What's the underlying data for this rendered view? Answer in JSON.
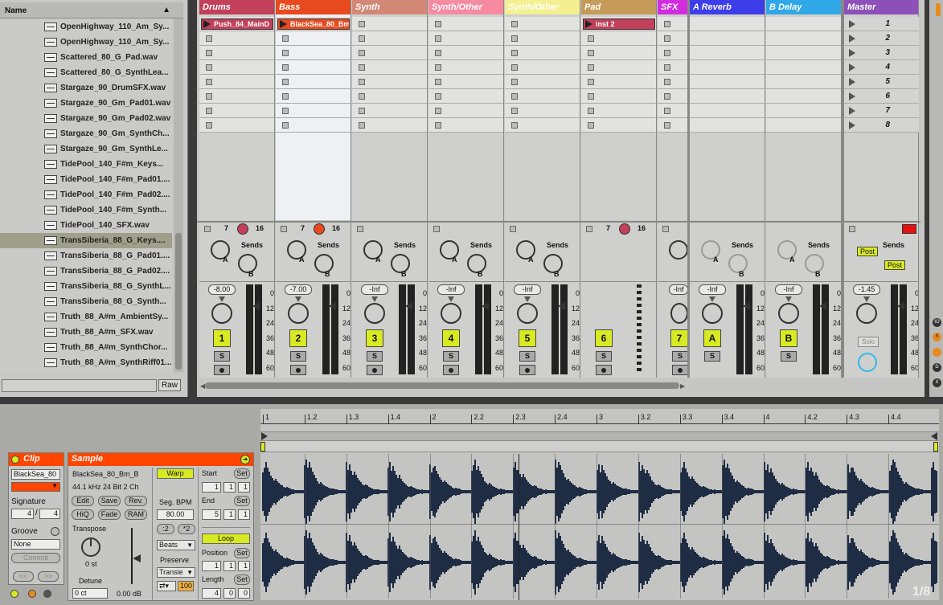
{
  "browser": {
    "header": "Name",
    "files": [
      "OpenHighway_110_Am_Sy...",
      "OpenHighway_110_Am_Sy...",
      "Scattered_80_G_Pad.wav",
      "Scattered_80_G_SynthLea...",
      "Stargaze_90_DrumSFX.wav",
      "Stargaze_90_Gm_Pad01.wav",
      "Stargaze_90_Gm_Pad02.wav",
      "Stargaze_90_Gm_SynthCh...",
      "Stargaze_90_Gm_SynthLe...",
      "TidePool_140_F#m_Keys...",
      "TidePool_140_F#m_Pad01....",
      "TidePool_140_F#m_Pad02....",
      "TidePool_140_F#m_Synth...",
      "TidePool_140_SFX.wav",
      "TransSiberia_88_G_Keys....",
      "TransSiberia_88_G_Pad01....",
      "TransSiberia_88_G_Pad02....",
      "TransSiberia_88_G_SynthL...",
      "TransSiberia_88_G_Synth...",
      "Truth_88_A#m_AmbientSy...",
      "Truth_88_A#m_SFX.wav",
      "Truth_88_A#m_SynthChor...",
      "Truth_88_A#m_SynthRiff01..."
    ],
    "selected_index": 14,
    "raw_label": "Raw"
  },
  "tracks": [
    {
      "name": "Drums",
      "color": "#c2405a",
      "clip": "Push_84_MainD",
      "clip_color": "#c2405a",
      "vol": "-8.00",
      "num": "1",
      "solo": "S",
      "ctr_a": "7",
      "ctr_b": "16"
    },
    {
      "name": "Bass",
      "color": "#e84a1f",
      "clip": "BlackSea_80_Bm",
      "clip_color": "#e84a1f",
      "vol": "-7.00",
      "num": "2",
      "solo": "S",
      "ctr_a": "7",
      "ctr_b": "16"
    },
    {
      "name": "Synth",
      "color": "#d38876",
      "clip": "",
      "clip_color": "",
      "vol": "-Inf",
      "num": "3",
      "solo": "S",
      "ctr_a": "",
      "ctr_b": ""
    },
    {
      "name": "Synth/Other",
      "color": "#f58aa1",
      "clip": "",
      "clip_color": "",
      "vol": "-Inf",
      "num": "4",
      "solo": "S",
      "ctr_a": "",
      "ctr_b": ""
    },
    {
      "name": "Synth/Other",
      "color": "#f4f090",
      "clip": "",
      "clip_color": "",
      "vol": "-Inf",
      "num": "5",
      "solo": "S",
      "ctr_a": "",
      "ctr_b": ""
    },
    {
      "name": "Pad",
      "color": "#c69a58",
      "clip": "inst 2",
      "clip_color": "#c2405a",
      "vol": "",
      "num": "6",
      "solo": "S",
      "ctr_a": "7",
      "ctr_b": "16"
    },
    {
      "name": "SFX",
      "color": "#d22cdf",
      "clip": "",
      "clip_color": "",
      "vol": "-Inf",
      "num": "7",
      "solo": "S",
      "ctr_a": "",
      "ctr_b": ""
    },
    {
      "name": "A Reverb",
      "color": "#3d3dea",
      "clip": "",
      "clip_color": "",
      "vol": "-Inf",
      "num": "A",
      "solo": "S",
      "ctr_a": "",
      "ctr_b": ""
    },
    {
      "name": "B Delay",
      "color": "#30a8e8",
      "clip": "",
      "clip_color": "",
      "vol": "-Inf",
      "num": "B",
      "solo": "S",
      "ctr_a": "",
      "ctr_b": ""
    },
    {
      "name": "Master",
      "color": "#8d4fb8",
      "clip": "",
      "clip_color": "",
      "vol": "-1.45",
      "num": "",
      "solo": "Solo",
      "ctr_a": "",
      "ctr_b": ""
    }
  ],
  "scenes": [
    "1",
    "2",
    "3",
    "4",
    "5",
    "6",
    "7",
    "8"
  ],
  "sends": {
    "label": "Sends",
    "a": "A",
    "b": "B",
    "post": "Post"
  },
  "meter_scale": [
    "0",
    "12",
    "24",
    "36",
    "48",
    "60"
  ],
  "clip_panel": {
    "title": "Clip",
    "name": "BlackSea_80",
    "signature_label": "Signature",
    "sig_num": "4",
    "sig_sep": "/",
    "sig_den": "4",
    "groove_label": "Groove",
    "groove_value": "None",
    "commit": "Commit",
    "nav_left": "<<",
    "nav_right": ">>",
    "color": "#ff4500"
  },
  "sample_panel": {
    "title": "Sample",
    "file": "BlackSea_80_Bm_B",
    "info": "44.1 kHz 24 Bit 2 Ch",
    "edit": "Edit",
    "save": "Save",
    "rev": "Rev.",
    "hiq": "HiQ",
    "fade": "Fade",
    "ram": "RAM",
    "transpose_label": "Transpose",
    "transpose_value": "0 st",
    "detune_label": "Detune",
    "detune_value": "0 ct",
    "gain_value": "0.00 dB",
    "warp": "Warp",
    "seg_bpm_label": "Seg. BPM",
    "seg_bpm": "80.00",
    "half": ":2",
    "double": "*2",
    "warp_mode": "Beats",
    "preserve_label": "Preserve",
    "preserve_value": "Transie",
    "grain": "100",
    "start_label": "Start",
    "end_label": "End",
    "set": "Set",
    "start": [
      "1",
      "1",
      "1"
    ],
    "end": [
      "5",
      "1",
      "1"
    ],
    "loop": "Loop",
    "position_label": "Position",
    "position": [
      "1",
      "1",
      "1"
    ],
    "length_label": "Length",
    "length": [
      "4",
      "0",
      "0"
    ]
  },
  "ruler": [
    "1",
    "1.2",
    "1.3",
    "1.4",
    "2",
    "2.2",
    "2.3",
    "2.4",
    "3",
    "3.2",
    "3.3",
    "3.4",
    "4",
    "4.2",
    "4.3",
    "4.4"
  ],
  "zoom_label": "1/8"
}
